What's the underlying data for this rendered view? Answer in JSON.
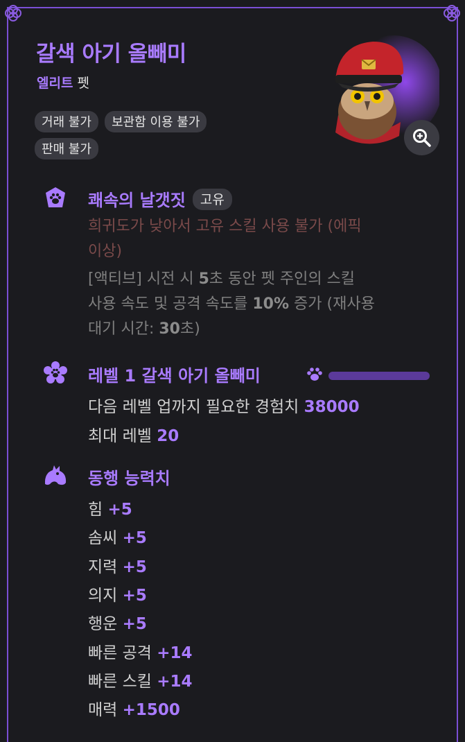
{
  "item": {
    "name": "갈색 아기 올빼미",
    "grade": "엘리트",
    "kind": "펫",
    "tags": [
      "거래 불가",
      "보관함 이용 불가",
      "판매 불가"
    ]
  },
  "skill": {
    "name": "쾌속의 날갯짓",
    "badge": "고유",
    "restriction": [
      "희귀도가 낮아서 고유 스킬 사용 불가 (에픽",
      "이상)"
    ],
    "desc_line1_a": "[액티브] 시전 시 ",
    "desc_line1_b": "5",
    "desc_line1_c": "초 동안 펫 주인의 스킬",
    "desc_line2_a": "사용 속도 및 공격 속도를 ",
    "desc_line2_b": "10%",
    "desc_line2_c": " 증가 (재사용",
    "desc_line3_a": "대기 시간: ",
    "desc_line3_b": "30",
    "desc_line3_c": "초)"
  },
  "level": {
    "title": "레벨 1 갈색 아기 올빼미",
    "exp_label": "다음 레벨 업까지 필요한 경험치 ",
    "exp_value": "38000",
    "max_label": "최대 레벨 ",
    "max_value": "20",
    "exp_progress": 0
  },
  "stats": {
    "title": "동행 능력치",
    "items": [
      {
        "label": "힘 ",
        "value": "+5"
      },
      {
        "label": "솜씨 ",
        "value": "+5"
      },
      {
        "label": "지력 ",
        "value": "+5"
      },
      {
        "label": "의지 ",
        "value": "+5"
      },
      {
        "label": "행운 ",
        "value": "+5"
      },
      {
        "label": "빠른 공격 ",
        "value": "+14"
      },
      {
        "label": "빠른 스킬 ",
        "value": "+14"
      },
      {
        "label": "매력 ",
        "value": "+1500"
      }
    ]
  },
  "icons": {
    "zoom": "zoom-in-icon",
    "skill": "paw-shield-icon",
    "level": "paw-flower-icon",
    "stats": "pet-silhouette-icon"
  },
  "colors": {
    "accent": "#a97bff",
    "background": "#1b1b1f",
    "tag_bg": "#3a3a41",
    "restriction": "#7a4a4a"
  }
}
